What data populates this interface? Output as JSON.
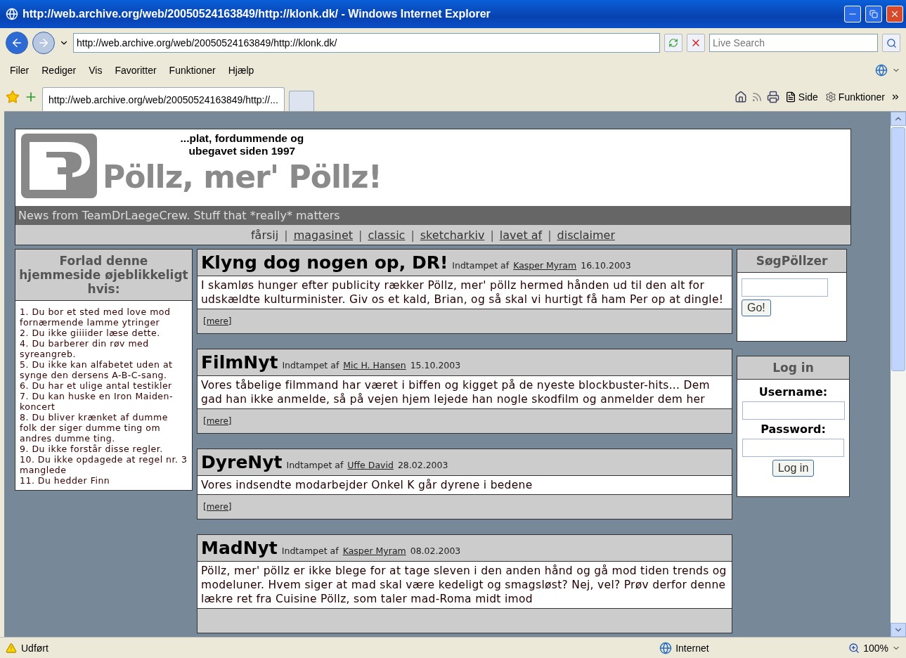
{
  "window": {
    "title": "http://web.archive.org/web/20050524163849/http://klonk.dk/ - Windows Internet Explorer"
  },
  "address_bar": {
    "url": "http://web.archive.org/web/20050524163849/http://klonk.dk/"
  },
  "search": {
    "placeholder": "Live Search"
  },
  "menu": [
    "Filer",
    "Rediger",
    "Vis",
    "Favoritter",
    "Funktioner",
    "Hjælp"
  ],
  "tabs": [
    {
      "label": "http://web.archive.org/web/20050524163849/http://...",
      "selected": true
    }
  ],
  "command_bar": {
    "page": "Side",
    "tools": "Funktioner"
  },
  "page": {
    "tagline": [
      "...plat, fordummende og",
      "ubegavet siden 1997"
    ],
    "title": "Pöllz, mer' Pöllz!",
    "subtitle": "News from TeamDrLaegeCrew. Stuff that *really* matters",
    "nav_separator": "|",
    "nav": [
      {
        "label": "fårsij",
        "selected": true
      },
      {
        "label": "magasinet",
        "selected": false
      },
      {
        "label": "classic",
        "selected": false
      },
      {
        "label": "sketcharkiv",
        "selected": false
      },
      {
        "label": "lavet af",
        "selected": false
      },
      {
        "label": "disclaimer",
        "selected": false
      }
    ],
    "sidebar": {
      "title": "Forlad denne hjemmeside øjeblikkeligt hvis:",
      "rules": [
        "1. Du bor et sted med love mod fornærmende lamme ytringer",
        "2. Du ikke giiiider læse dette.",
        "4. Du barberer din røv med syreangreb.",
        "5. Du ikke kan alfabetet uden at synge den dersens A-B-C-sang.",
        "6. Du har et ulige antal testikler",
        "7. Du kan huske en Iron Maiden-koncert",
        "8. Du bliver krænket af dumme folk der siger dumme ting om andres dumme ting.",
        "9. Du ikke forstår disse regler.",
        "10. Du ikke opdagede at regel nr. 3 manglede",
        "11. Du hedder Finn"
      ]
    },
    "articles": [
      {
        "title": "Klyng dog nogen op, DR!",
        "byline": "Indtampet af",
        "author": "Kasper Myram",
        "date": "16.10.2003",
        "body": "I skamløs hunger efter publicity rækker Pöllz, mer' pöllz hermed hånden ud til den alt for udskældte kulturminister. Giv os et kald, Brian, og så skal vi hurtigt få ham Per op at dingle!",
        "more": "[mere]"
      },
      {
        "title": "FilmNyt",
        "byline": "Indtampet af",
        "author": "Mic H. Hansen",
        "date": "15.10.2003",
        "body": "Vores tåbelige filmmand har været i biffen og kigget på de nyeste blockbuster-hits... Dem gad han ikke anmelde, så på vejen hjem lejede han nogle skodfilm og anmelder dem her",
        "more": "[mere]"
      },
      {
        "title": "DyreNyt",
        "byline": "Indtampet af",
        "author": "Uffe David",
        "date": "28.02.2003",
        "body": "Vores indsendte modarbejder Onkel K går dyrene i bedene",
        "more": "[mere]"
      },
      {
        "title": "MadNyt",
        "byline": "Indtampet af",
        "author": "Kasper Myram",
        "date": "08.02.2003",
        "body": "Pöllz, mer' pöllz er ikke blege for at tage sleven i den anden hånd og gå mod tiden trends og modeluner. Hvem siger at mad skal være kedeligt og smagsløst? Nej, vel? Prøv derfor denne lækre ret fra Cuisine Pöllz, som taler mad-Roma midt imod"
      }
    ],
    "search_box": {
      "title": "SøgPöllzer",
      "button": "Go!"
    },
    "login_box": {
      "title": "Log in",
      "username_label": "Username:",
      "password_label": "Password:",
      "button": "Log in"
    }
  },
  "status_bar": {
    "status": "Udført",
    "zone": "Internet",
    "zoom": "100%"
  }
}
